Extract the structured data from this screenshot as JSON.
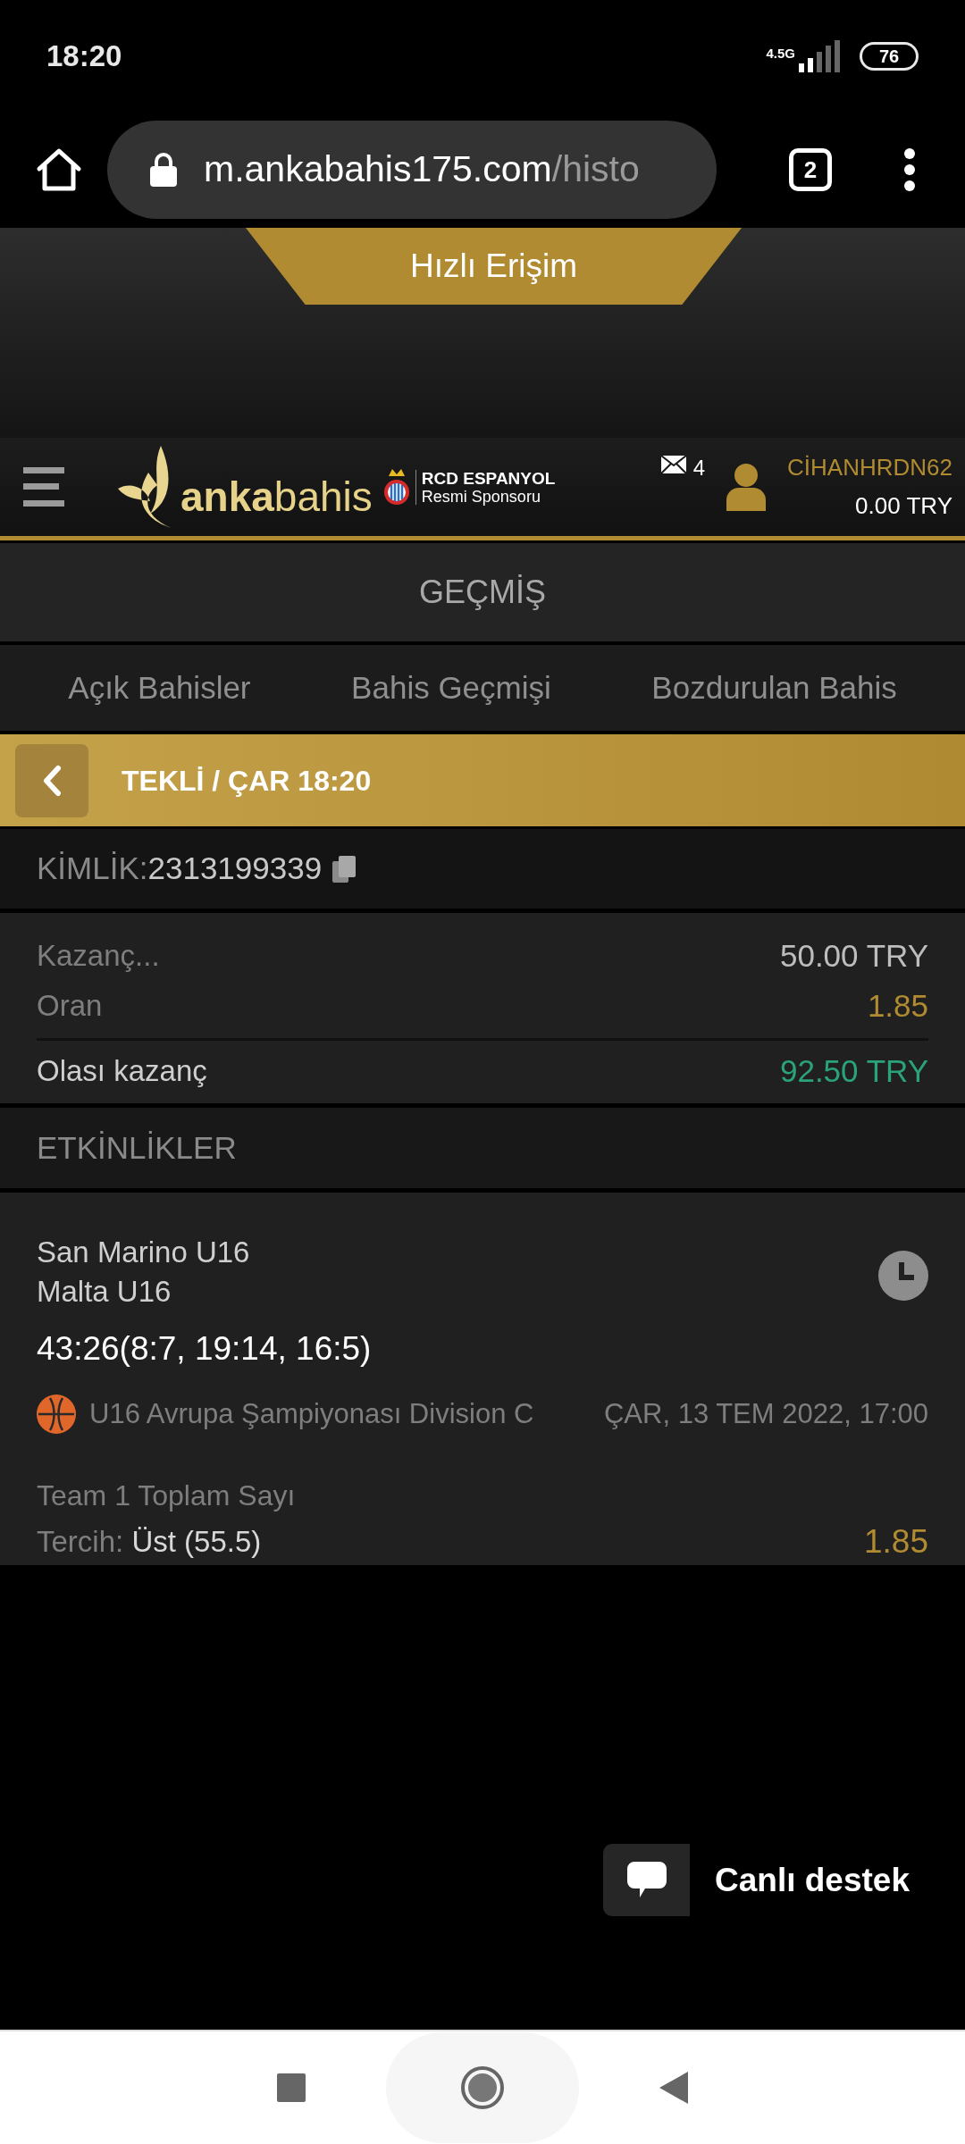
{
  "status_bar": {
    "time": "18:20",
    "network": "4.5G",
    "battery": "76"
  },
  "browser": {
    "url_host": "m.ankabahis175.com",
    "url_path": "/histo",
    "tab_count": "2"
  },
  "quick_access": "Hızlı Erişim",
  "header": {
    "logo_bold": "anka",
    "logo_light": "bahis",
    "sponsor_name": "RCD ESPANYOL",
    "sponsor_role": "Resmi Sponsoru",
    "messages": "4",
    "username": "CİHANHRDN62",
    "balance": "0.00 TRY"
  },
  "page_title": "GEÇMİŞ",
  "tabs": [
    "Açık Bahisler",
    "Bahis Geçmişi",
    "Bozdurulan Bahis"
  ],
  "bet_header": "TEKLİ / ÇAR 18:20",
  "id_label": "KİMLİK:",
  "id_value": "2313199339",
  "summary": [
    {
      "label": "Kazanç...",
      "value": "50.00 TRY",
      "kind": "plain"
    },
    {
      "label": "Oran",
      "value": "1.85",
      "kind": "odds"
    },
    {
      "label": "Olası kazanç",
      "value": "92.50 TRY",
      "kind": "win"
    }
  ],
  "events_title": "ETKİNLİKLER",
  "event": {
    "home": "San Marino U16",
    "away": "Malta U16",
    "score": "43:26(8:7, 19:14, 16:5)",
    "league": "U16 Avrupa Şampiyonası Division C",
    "date": "ÇAR, 13 TEM 2022, 17:00",
    "market": "Team 1 Toplam Sayı",
    "pick_label": "Tercih:",
    "pick_value": "Üst (55.5)",
    "odds": "1.85"
  },
  "support": "Canlı destek"
}
